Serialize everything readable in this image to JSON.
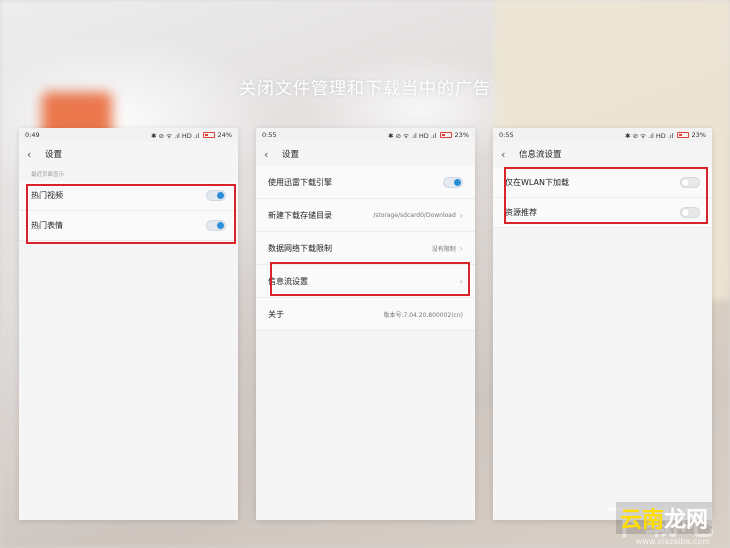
{
  "headline": "关闭文件管理和下载当中的广告",
  "colors": {
    "accent": "#2b8fd8",
    "highlight_box": "#d9232a",
    "battery": "#e0403a"
  },
  "screens": [
    {
      "status": {
        "time": "0:49",
        "icons": "✱ ⊘ ᯤ .ıl HD .ıl",
        "battery": "24%"
      },
      "title": "设置",
      "section_hint": "最近页面显示",
      "rows": [
        {
          "label": "热门视频",
          "toggle": "on"
        },
        {
          "label": "热门表情",
          "toggle": "on"
        }
      ]
    },
    {
      "status": {
        "time": "0:55",
        "icons": "✱ ⊘ ᯤ .ıl HD .ıl",
        "battery": "23%"
      },
      "title": "设置",
      "rows": [
        {
          "label": "使用迅雷下载引擎",
          "toggle": "on"
        },
        {
          "label": "新建下载存储目录",
          "value": "/storage/sdcard0/Download"
        },
        {
          "label": "数据网络下载限制",
          "value": "没有限制"
        },
        {
          "label": "信息流设置",
          "value": ""
        },
        {
          "label": "关于",
          "value": "版本号:7.04.20.800002(cn)"
        }
      ]
    },
    {
      "status": {
        "time": "0:55",
        "icons": "✱ ⊘ ᯤ .ıl HD .ıl",
        "battery": "23%"
      },
      "title": "信息流设置",
      "rows": [
        {
          "label": "仅在WLAN下加载",
          "toggle": "off"
        },
        {
          "label": "资源推荐",
          "toggle": "off"
        }
      ]
    }
  ],
  "watermark": {
    "big": "下载吧",
    "brand_a": "云南",
    "brand_b": "龙网",
    "url": "www.xiazaiba.com"
  }
}
